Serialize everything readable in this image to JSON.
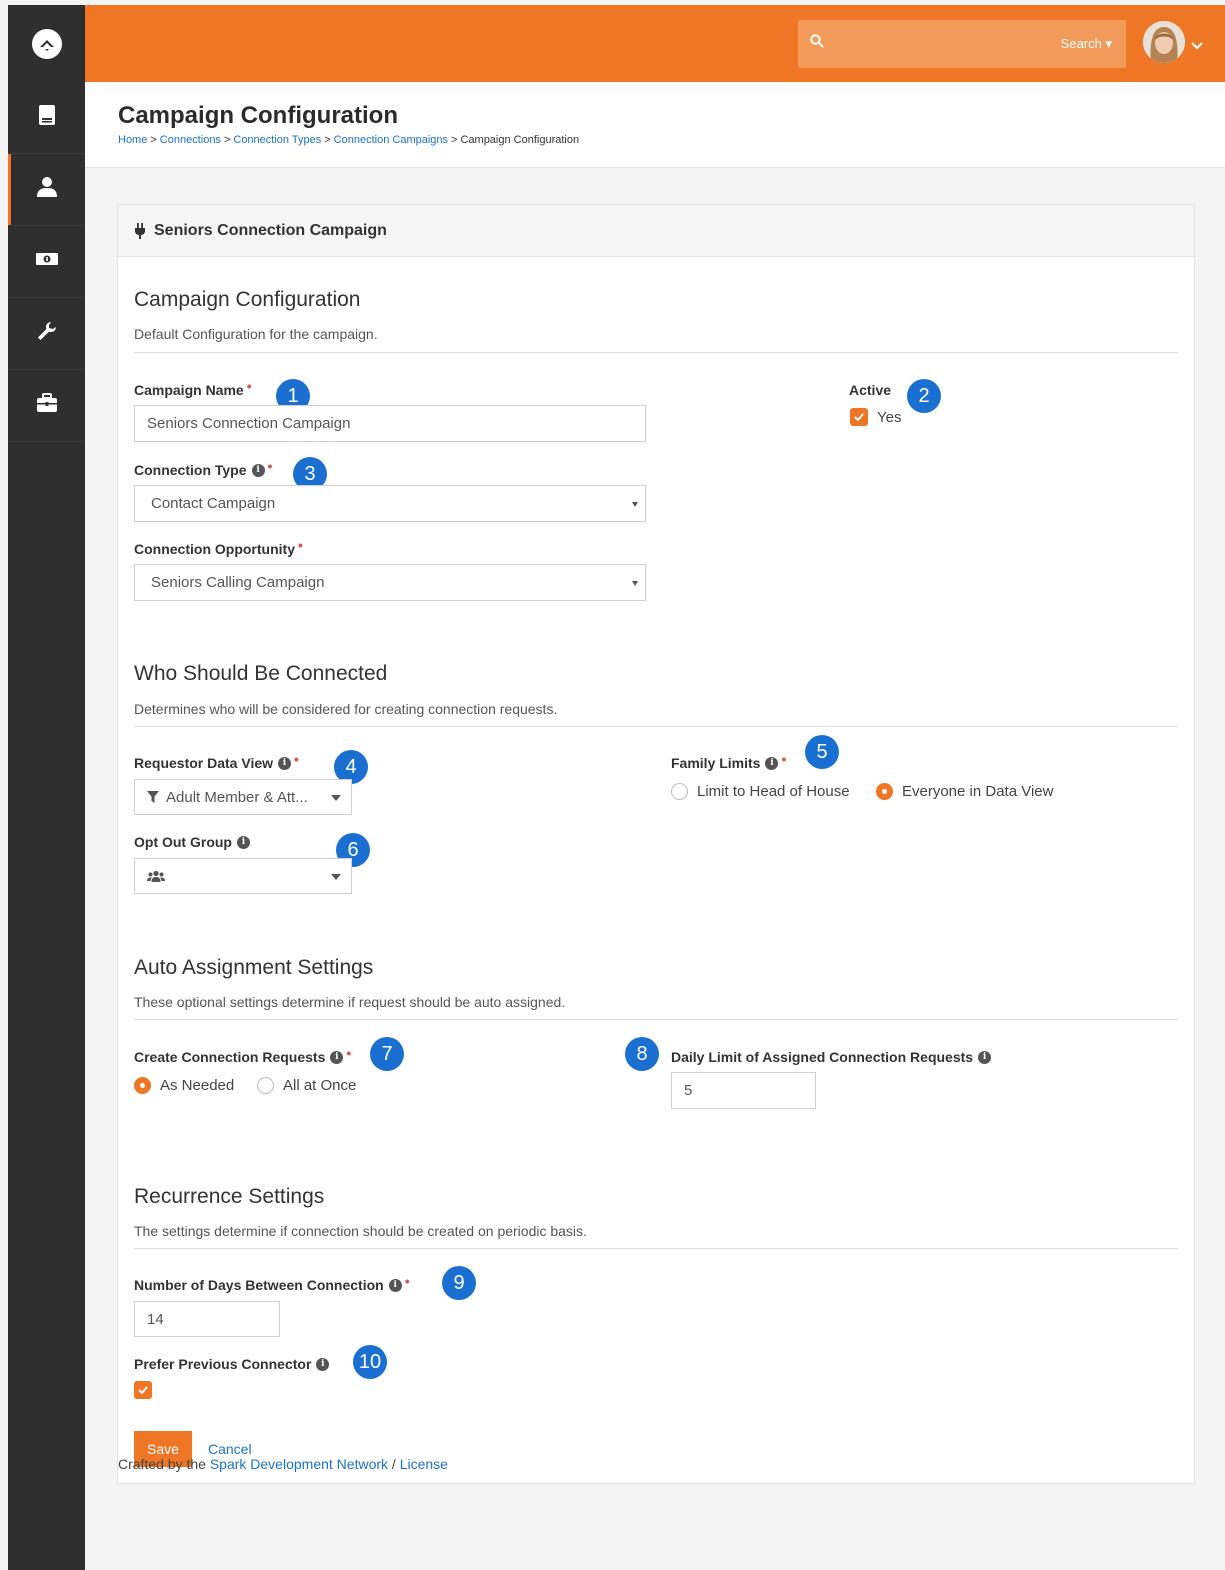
{
  "topbar": {
    "search_label": "Search ▾"
  },
  "header": {
    "title": "Campaign Configuration",
    "breadcrumb": [
      "Home",
      "Connections",
      "Connection Types",
      "Connection Campaigns",
      "Campaign Configuration"
    ]
  },
  "panel": {
    "heading": "Seniors Connection Campaign"
  },
  "campaign": {
    "section_title": "Campaign Configuration",
    "section_desc": "Default Configuration for the campaign.",
    "name_label": "Campaign Name",
    "name_value": "Seniors Connection Campaign",
    "active_label": "Active",
    "active_option": "Yes",
    "type_label": "Connection Type",
    "type_value": "Contact Campaign",
    "opportunity_label": "Connection Opportunity",
    "opportunity_value": "Seniors Calling Campaign"
  },
  "who": {
    "section_title": "Who Should Be Connected",
    "section_desc": "Determines who will be considered for creating connection requests.",
    "dataview_label": "Requestor Data View",
    "dataview_value": "Adult Member & Att...",
    "family_label": "Family Limits",
    "family_option_1": "Limit to Head of House",
    "family_option_2": "Everyone in Data View",
    "optout_label": "Opt Out Group"
  },
  "auto": {
    "section_title": "Auto Assignment Settings",
    "section_desc": "These optional settings determine if request should be auto assigned.",
    "create_label": "Create Connection Requests",
    "create_option_1": "As Needed",
    "create_option_2": "All at Once",
    "limit_label": "Daily Limit of Assigned Connection Requests",
    "limit_value": "5"
  },
  "recurrence": {
    "section_title": "Recurrence Settings",
    "section_desc": "The settings determine if connection should be created on periodic basis.",
    "days_label": "Number of Days Between Connection",
    "days_value": "14",
    "prefer_label": "Prefer Previous Connector"
  },
  "actions": {
    "save_label": "Save",
    "cancel_label": "Cancel"
  },
  "badges": [
    "1",
    "2",
    "3",
    "4",
    "5",
    "6",
    "7",
    "8",
    "9",
    "10"
  ],
  "footer": {
    "prefix": "Crafted by the ",
    "link1": "Spark Development Network",
    "sep": " / ",
    "link2": "License"
  },
  "colors": {
    "accent": "#ee7625",
    "badge": "#1a6fd1",
    "link": "#1a73c7",
    "sidebar": "#2f2f2f"
  },
  "icons": {
    "sidebar": [
      "rock-logo-icon",
      "book-icon",
      "person-icon",
      "money-icon",
      "wrench-icon",
      "briefcase-icon"
    ],
    "panel": "plug-icon",
    "search": "search-icon"
  }
}
